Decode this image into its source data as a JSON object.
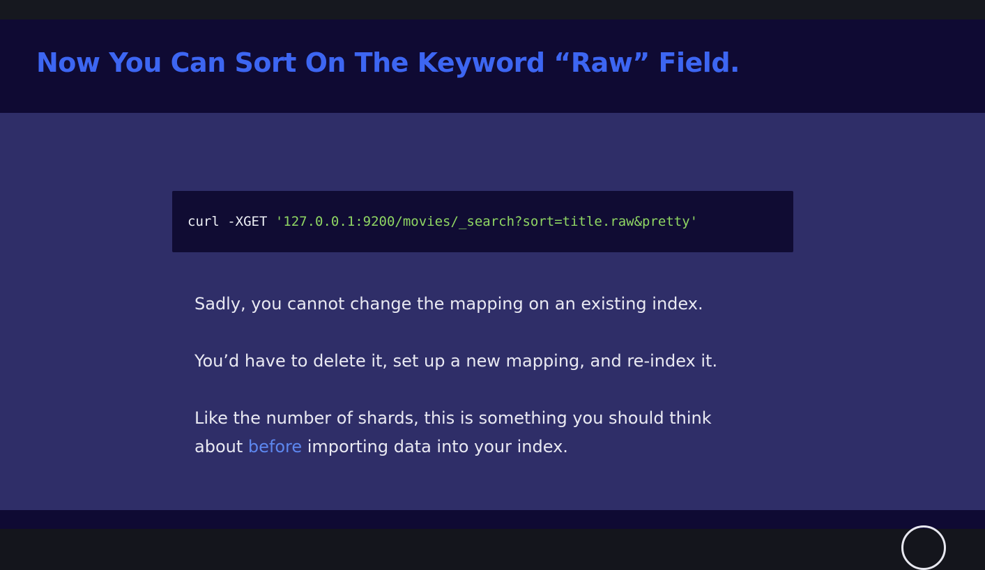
{
  "slide": {
    "title": "Now You Can Sort On The Keyword “Raw” Field.",
    "code": {
      "command": "curl -XGET ",
      "url": "'127.0.0.1:9200/movies/_search?sort=title.raw&pretty'"
    },
    "paragraphs": {
      "p1": "Sadly, you cannot change the mapping on an existing index.",
      "p2": "You’d have to delete it, set up a new mapping, and re-index it.",
      "p3_line1": "Like the number of shards, this is something you should think",
      "p3_before": "about ",
      "p3_highlight": "before",
      "p3_after": " importing data into your index."
    }
  },
  "colors": {
    "title": "#3d66f2",
    "header_bg": "#0f0a33",
    "content_bg": "#2f2e68",
    "code_bg": "#100c33",
    "code_url": "#8fd663",
    "highlight": "#5d87ef"
  },
  "icons": {
    "corner_badge": "circle-logo-icon"
  }
}
